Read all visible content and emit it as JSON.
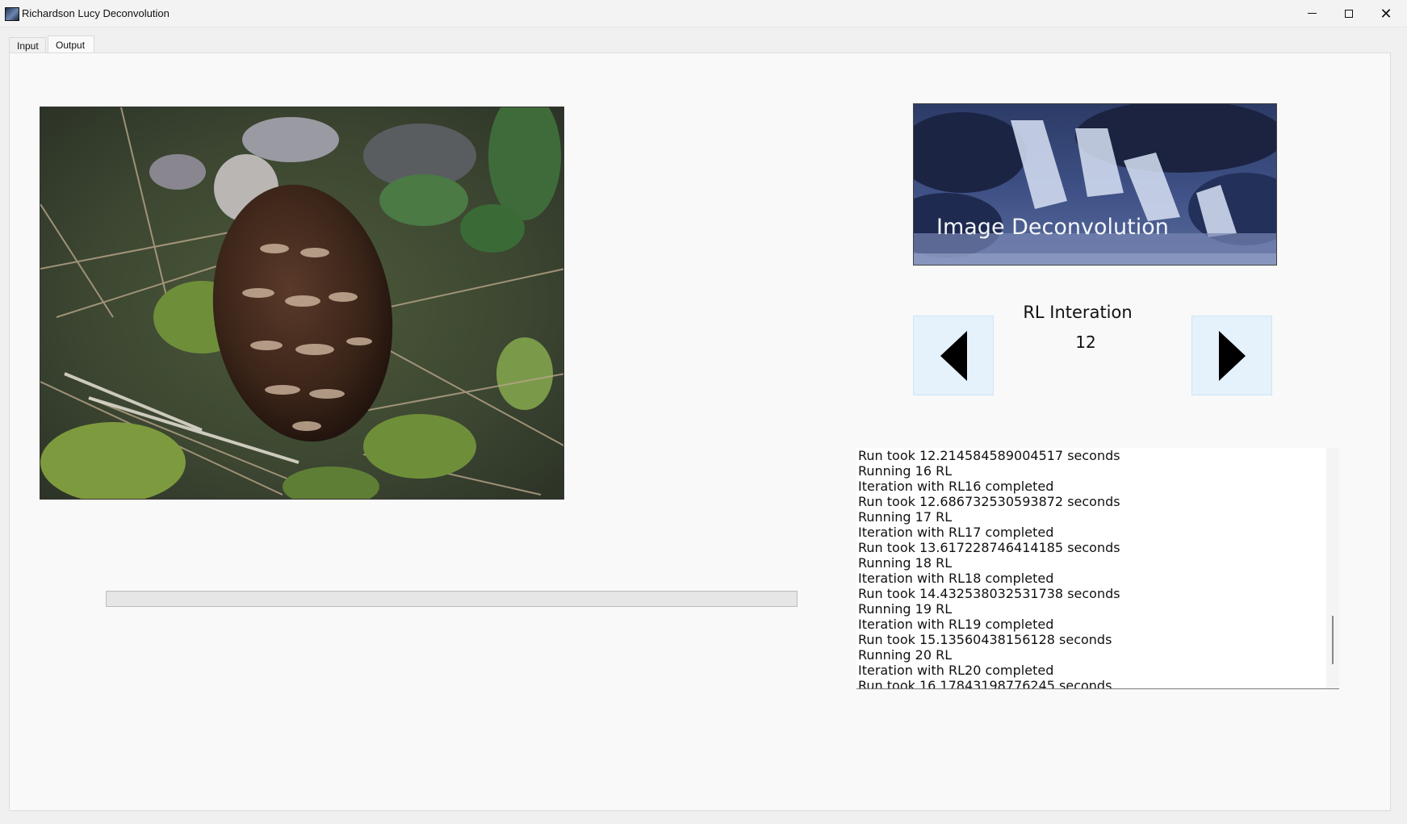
{
  "window": {
    "title": "Richardson Lucy Deconvolution",
    "controls": [
      "minimize-icon",
      "maximize-icon",
      "close-icon"
    ],
    "close_glyph": "✕"
  },
  "tabs": [
    {
      "label": "Input",
      "selected": false
    },
    {
      "label": "Output",
      "selected": true
    }
  ],
  "banner": {
    "title": "Image Deconvolution"
  },
  "rl": {
    "label": "RL Interation",
    "value": "12"
  },
  "nav": {
    "prev_icon": "arrow-left-icon",
    "next_icon": "arrow-right-icon"
  },
  "progress": {
    "value_percent": 0
  },
  "log": {
    "lines": [
      "Run took 12.214584589004517 seconds",
      "Running 16 RL",
      "Iteration with RL16 completed",
      "Run took 12.686732530593872 seconds",
      "Running 17 RL",
      "Iteration with RL17 completed",
      "Run took 13.617228746414185 seconds",
      "Running 18 RL",
      "Iteration with RL18 completed",
      "Run took 14.432538032531738 seconds",
      "Running 19 RL",
      "Iteration with RL19 completed",
      "Run took 15.13560438156128 seconds",
      "Running 20 RL",
      "Iteration with RL20 completed",
      "Run took 16.17843198776245 seconds"
    ]
  },
  "colors": {
    "button_bg": "#e5f1fb",
    "panel_bg": "#f9f9f9"
  }
}
